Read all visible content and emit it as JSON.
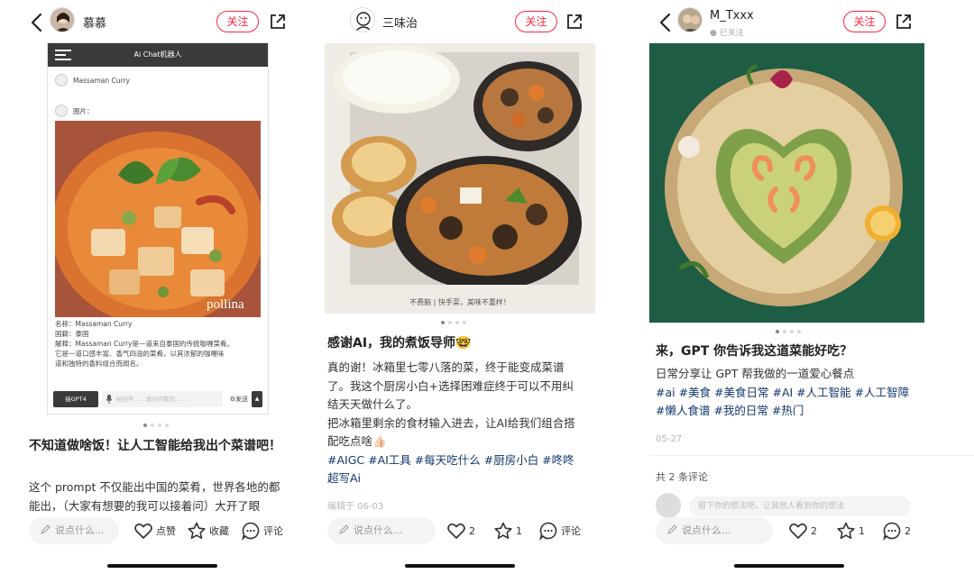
{
  "icons": {
    "back": "chevron-left-icon",
    "share": "share-external-icon",
    "like": "heart-icon",
    "collect": "star-icon",
    "comment": "comment-bubble-icon",
    "edit": "pencil-icon"
  },
  "colors": {
    "accent": "#ff2741",
    "tag": "#13386c",
    "follow_border": "#ff2741"
  },
  "common": {
    "follow_label": "关注",
    "comment_placeholder": "说点什么..."
  },
  "posts": [
    {
      "author": "慕慕",
      "chat": {
        "header_title": "Ai Chat机器人",
        "user_query": "Massaman Curry",
        "image_label": "图片：",
        "watermark": "pollina",
        "info_lines": [
          "名称：Massaman Curry",
          "国籍：泰国",
          "解释：Massaman Curry是一道来自泰国的传统咖喱菜肴。",
          "它是一道口感丰富、香气四溢的菜肴，以其浓郁的咖喱味",
          "道和独特的香料组合而闻名。"
        ],
        "model_button": "接GPT4",
        "input_placeholder": "给回答……请问问我的……",
        "send_label": "发送"
      },
      "title": "不知道做啥饭！让人工智能给我出个菜谱吧！",
      "body": "这个 prompt 不仅能出中国的菜肴，世界各地的都能出，（大家有想要的我可以接着问）大开了眼",
      "actions": {
        "like": "点赞",
        "collect": "收藏",
        "comment": "评论"
      }
    },
    {
      "author": "三味治",
      "image_caption": "不费脑 | 快手菜，美味不重样！",
      "title": "感谢AI，我的煮饭导师🤓",
      "body_lines": [
        "真的谢！冰箱里七零八落的菜，终于能变成菜谱了。我这个厨房小白+选择困难症终于可以不用纠结天天做什么了。",
        "把冰箱里剩余的食材输入进去，让AI给我们组合搭配吃点啥👍🏻"
      ],
      "tags": "#AIGC  #AI工具  #每天吃什么  #厨房小白  #咚咚超写Ai",
      "date": "编辑于 06-03",
      "actions": {
        "like": "2",
        "collect": "1",
        "comment": "评论"
      }
    },
    {
      "author": "M_Txxx",
      "author_sub": "● 已关注",
      "title": "来，GPT 你告诉我这道菜能好吃？",
      "body": "日常分享让 GPT 帮我做的一道爱心餐点",
      "tags": "#ai  #美食  #美食日常  #AI  #人工智能  #人工智障  #懒人食谱  #我的日常  #热门",
      "date": "05-27",
      "comments_count": "共 2 条评论",
      "comment_input": "留下你的想法吧，让其他人看到你的想法",
      "actions": {
        "like": "2",
        "collect": "1",
        "comment": "2"
      }
    }
  ]
}
